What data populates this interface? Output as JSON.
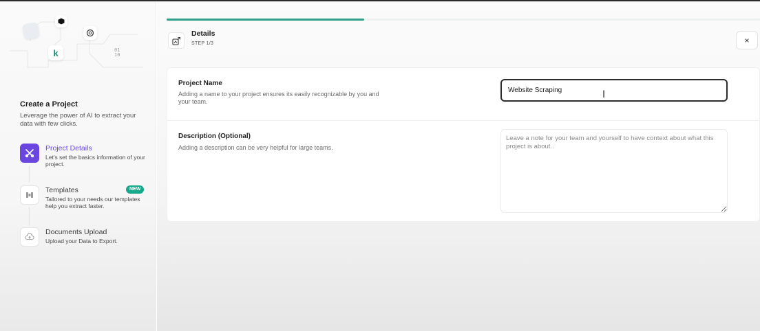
{
  "sidebar": {
    "title": "Create a Project",
    "description": "Leverage the power of AI to extract your data with few clicks.",
    "illustration": {
      "logo_letter": "k",
      "binary_text": "01\n10"
    },
    "steps": [
      {
        "title": "Project Details",
        "subtitle": "Let's set the basics information of your project.",
        "icon": "scissors-tools-icon",
        "active": true
      },
      {
        "title": "Templates",
        "subtitle": "Tailored to your needs our templates help you extract faster.",
        "icon": "grid-dots-icon",
        "badge": "NEW",
        "active": false
      },
      {
        "title": "Documents Upload",
        "subtitle": "Upload your Data to Export.",
        "icon": "cloud-upload-icon",
        "active": false
      }
    ]
  },
  "header": {
    "title": "Details",
    "step": "STEP 1/3",
    "close_label": "×"
  },
  "progress": {
    "percent": 33.3,
    "color": "#2a9d86"
  },
  "form": {
    "project_name": {
      "label": "Project Name",
      "help": "Adding a name to your project ensures its easily recognizable by you and your team.",
      "value": "Website Scraping"
    },
    "description": {
      "label": "Description (Optional)",
      "help": "Adding a description can be very helpful for large teams.",
      "placeholder": "Leave a note for your team and yourself to have context about what this project is about..",
      "value": ""
    }
  },
  "colors": {
    "accent_purple": "#6a45e0",
    "accent_green": "#18a88c"
  }
}
